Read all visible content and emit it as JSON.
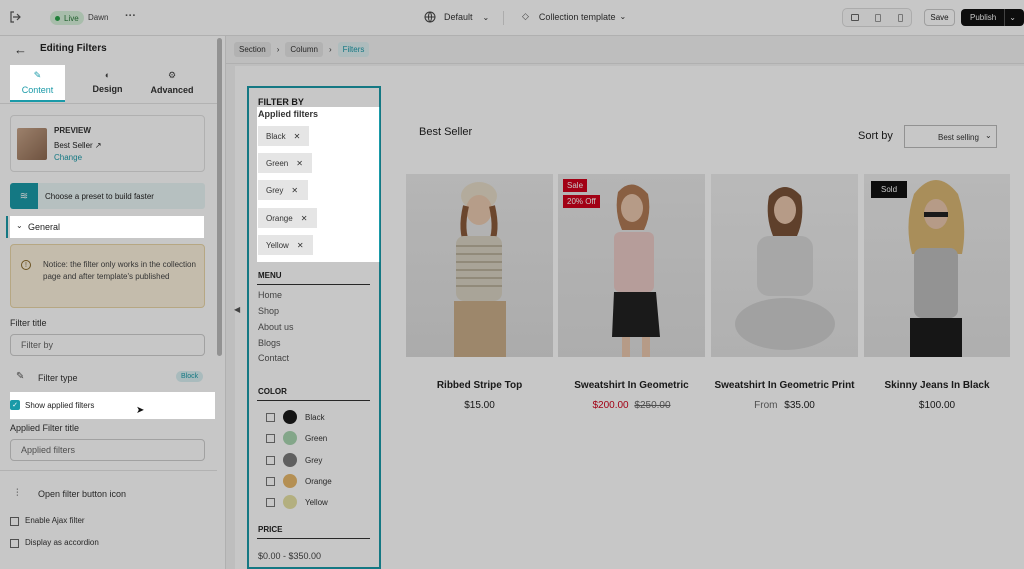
{
  "topbar": {
    "live": "Live",
    "theme": "Dawn",
    "more": "···",
    "language": "Default",
    "template": "Collection template",
    "save": "Save",
    "publish": "Publish"
  },
  "left": {
    "title": "Editing Filters",
    "tabs": [
      {
        "label": "Content"
      },
      {
        "label": "Design"
      },
      {
        "label": "Advanced"
      }
    ],
    "preview_label": "PREVIEW",
    "preview_name": "Best Seller",
    "preview_change": "Change",
    "preset": "Choose a preset to build faster",
    "general": "General",
    "notice": "Notice: the filter only works in the collection page and after template's published",
    "filter_title_label": "Filter title",
    "filter_title_value": "Filter by",
    "filter_type_label": "Filter type",
    "filter_type_badge": "Block",
    "show_applied": "Show applied filters",
    "applied_title_label": "Applied Filter title",
    "applied_title_value": "Applied filters",
    "open_icon": "Open filter button icon",
    "ajax": "Enable Ajax filter",
    "accordion": "Display as accordion"
  },
  "breadcrumb": [
    "Section",
    "Column",
    "Filters"
  ],
  "filters": {
    "heading": "FILTER BY",
    "applied_heading": "Applied filters",
    "applied": [
      "Black",
      "Green",
      "Grey",
      "Orange",
      "Yellow"
    ],
    "menu_heading": "MENU",
    "menu": [
      "Home",
      "Shop",
      "About us",
      "Blogs",
      "Contact"
    ],
    "color_heading": "COLOR",
    "colors": [
      {
        "label": "Black",
        "color": "#1a1a1a"
      },
      {
        "label": "Green",
        "color": "#a8d5b0"
      },
      {
        "label": "Grey",
        "color": "#7a7a7a"
      },
      {
        "label": "Orange",
        "color": "#e7b86b"
      },
      {
        "label": "Yellow",
        "color": "#e6e1a3"
      }
    ],
    "price_heading": "PRICE",
    "price_range": "$0.00 - $350.00"
  },
  "collection": {
    "title": "Best Seller",
    "sort_label": "Sort by",
    "sort_value": "Best selling",
    "products": [
      {
        "title": "Ribbed Stripe Top",
        "price": "$15.00",
        "compare": "",
        "prefix": "",
        "badges": []
      },
      {
        "title": "Sweatshirt In Geometric",
        "price": "$200.00",
        "compare": "$250.00",
        "prefix": "",
        "badges": [
          "Sale",
          "20% Off"
        ]
      },
      {
        "title": "Sweatshirt In Geometric Print",
        "price": "$35.00",
        "compare": "",
        "prefix": "From",
        "badges": []
      },
      {
        "title": "Skinny Jeans In Black",
        "price": "$100.00",
        "compare": "",
        "prefix": "",
        "badges": [
          "Sold"
        ]
      }
    ]
  },
  "colors": {
    "accent": "#1a9aa8",
    "sale": "#d0021b",
    "black": "#111111"
  }
}
